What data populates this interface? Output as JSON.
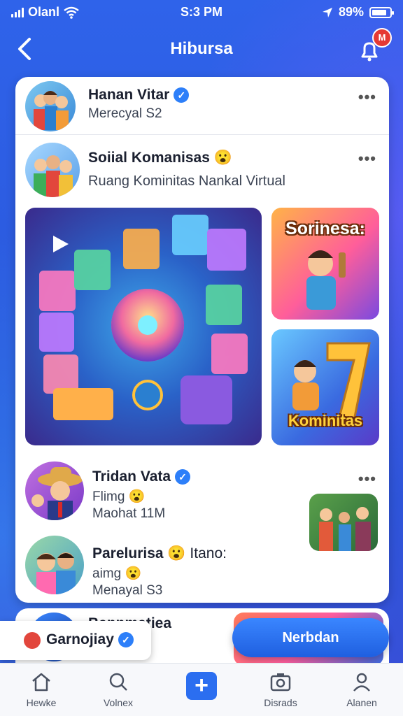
{
  "status_bar": {
    "carrier": "Olanl",
    "time": "S:3 PM",
    "battery": "89%"
  },
  "header": {
    "title": "Hibursa",
    "notification_count": "M"
  },
  "posts": [
    {
      "name": "Hanan Vitar",
      "subtitle": "Merecyal S2"
    },
    {
      "name": "Soiial Komanisas",
      "emoji": "😮",
      "subtitle": "Ruang Kominitas Nankal Virtual"
    }
  ],
  "tiles": {
    "top_right_label": "Sorinesa:",
    "bottom_right_label": "Kominitas"
  },
  "list_items": [
    {
      "name": "Tridan Vata",
      "line1": "Flimg",
      "emoji1": "😮",
      "line2": "Maohat 11M"
    },
    {
      "name": "Parelurisa",
      "emoji": "😮",
      "name_suffix": "Itano:",
      "line1": "aimg",
      "emoji1": "😮",
      "line2": "Menayal S3"
    }
  ],
  "next_card": {
    "name": "Bannmatiea"
  },
  "floating_pill": {
    "label": "Garnojiay"
  },
  "cta_button": {
    "label": "Nerbdan"
  },
  "tabbar": [
    {
      "label": "Hewke",
      "icon": "home-icon"
    },
    {
      "label": "Volnex",
      "icon": "search-icon"
    },
    {
      "label": "",
      "icon": "plus-icon"
    },
    {
      "label": "Disrads",
      "icon": "camera-icon"
    },
    {
      "label": "Alanen",
      "icon": "profile-icon"
    }
  ],
  "colors": {
    "primary": "#2b6ef0",
    "verified": "#2d7ff9",
    "badge": "#e53935"
  }
}
